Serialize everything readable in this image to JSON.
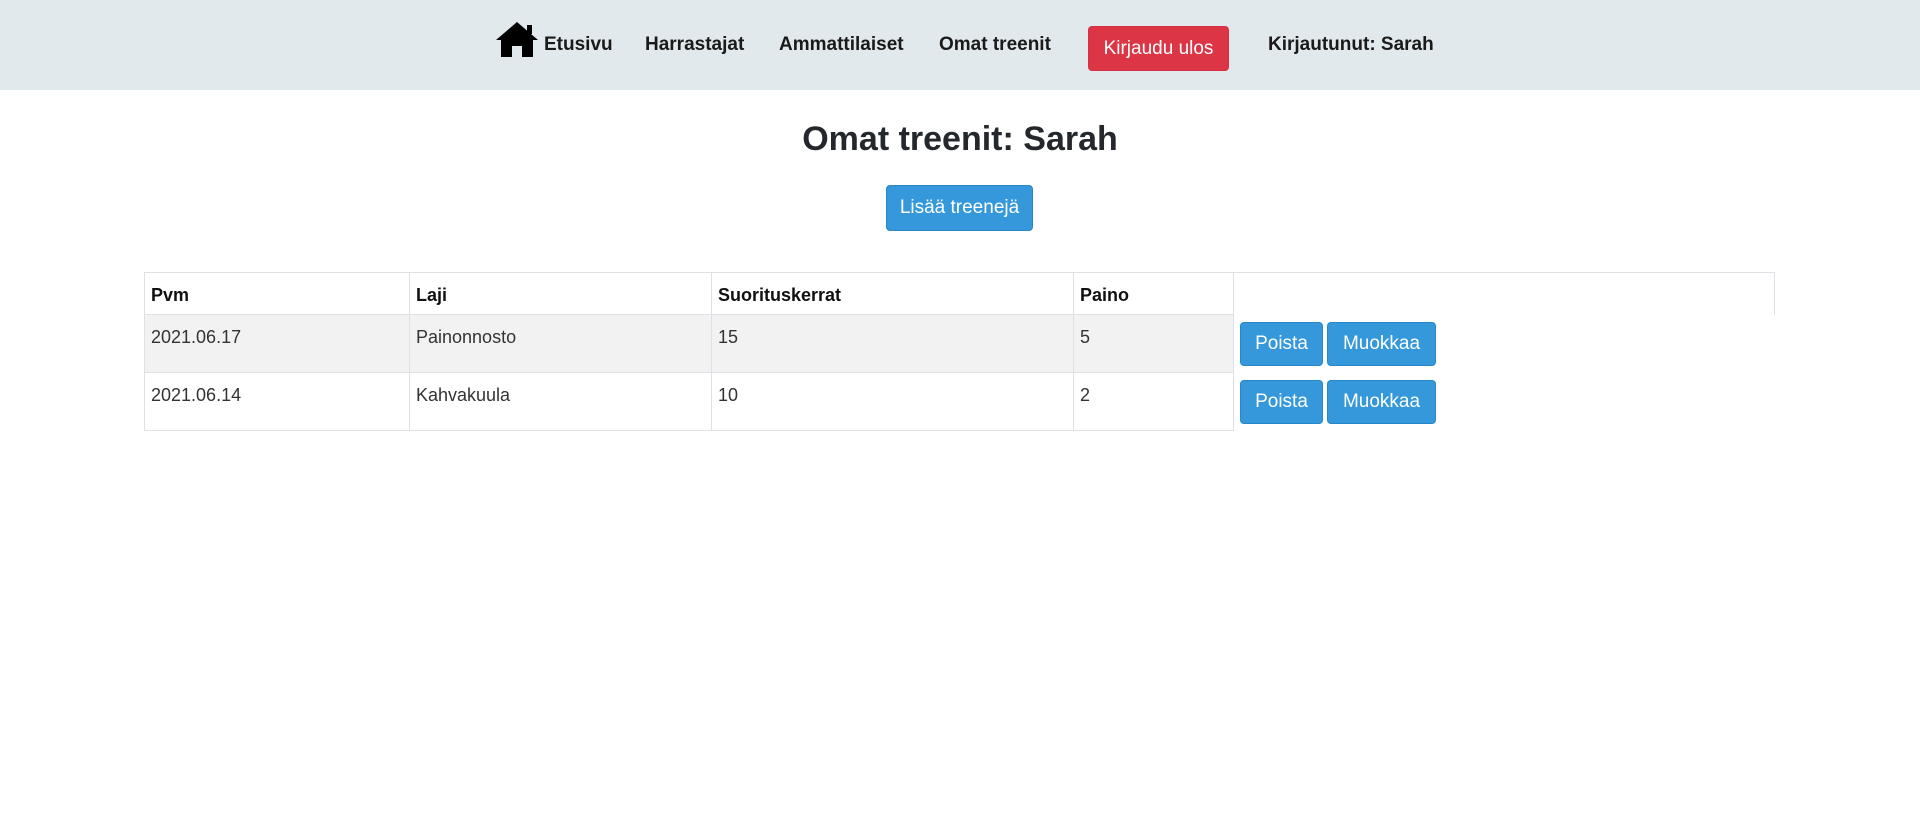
{
  "nav": {
    "home_icon": "home-icon",
    "home_label": "Etusivu",
    "hobbyists_label": "Harrastajat",
    "professionals_label": "Ammattilaiset",
    "my_workouts_label": "Omat treenit",
    "logout_label": "Kirjaudu ulos",
    "logged_in_text": "Kirjautunut: Sarah"
  },
  "main": {
    "title": "Omat treenit: Sarah",
    "add_button_label": "Lisää treenejä"
  },
  "table": {
    "headers": [
      "Pvm",
      "Laji",
      "Suorituskerrat",
      "Paino"
    ],
    "rows": [
      {
        "date": "2021.06.17",
        "sport": "Painonnosto",
        "reps": "15",
        "weight": "5"
      },
      {
        "date": "2021.06.14",
        "sport": "Kahvakuula",
        "reps": "10",
        "weight": "2"
      }
    ],
    "delete_label": "Poista",
    "edit_label": "Muokkaa"
  },
  "colors": {
    "navbar_bg": "#e2e9ec",
    "danger": "#dc3545",
    "primary": "#3498db",
    "striped_row": "#f2f2f2"
  }
}
